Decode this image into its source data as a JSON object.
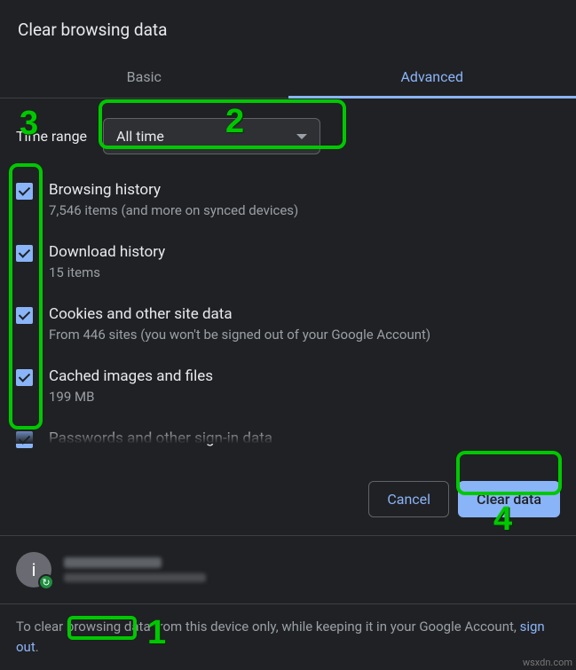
{
  "title": "Clear browsing data",
  "tabs": {
    "basic": "Basic",
    "advanced": "Advanced"
  },
  "time": {
    "label": "Time range",
    "selected": "All time"
  },
  "items": [
    {
      "title": "Browsing history",
      "desc": "7,546 items (and more on synced devices)"
    },
    {
      "title": "Download history",
      "desc": "15 items"
    },
    {
      "title": "Cookies and other site data",
      "desc": "From 446 sites (you won't be signed out of your Google Account)"
    },
    {
      "title": "Cached images and files",
      "desc": "199 MB"
    },
    {
      "title": "Passwords and other sign-in data",
      "desc": ""
    }
  ],
  "buttons": {
    "cancel": "Cancel",
    "clear": "Clear data"
  },
  "account": {
    "initial": "i"
  },
  "footer": {
    "pre": "To clear browsing data from this device only, while keeping it in your Google Account, ",
    "link": "sign out",
    "post": "."
  },
  "annotations": {
    "n1": "1",
    "n2": "2",
    "n3": "3",
    "n4": "4"
  },
  "watermark": "wsxdn.com"
}
